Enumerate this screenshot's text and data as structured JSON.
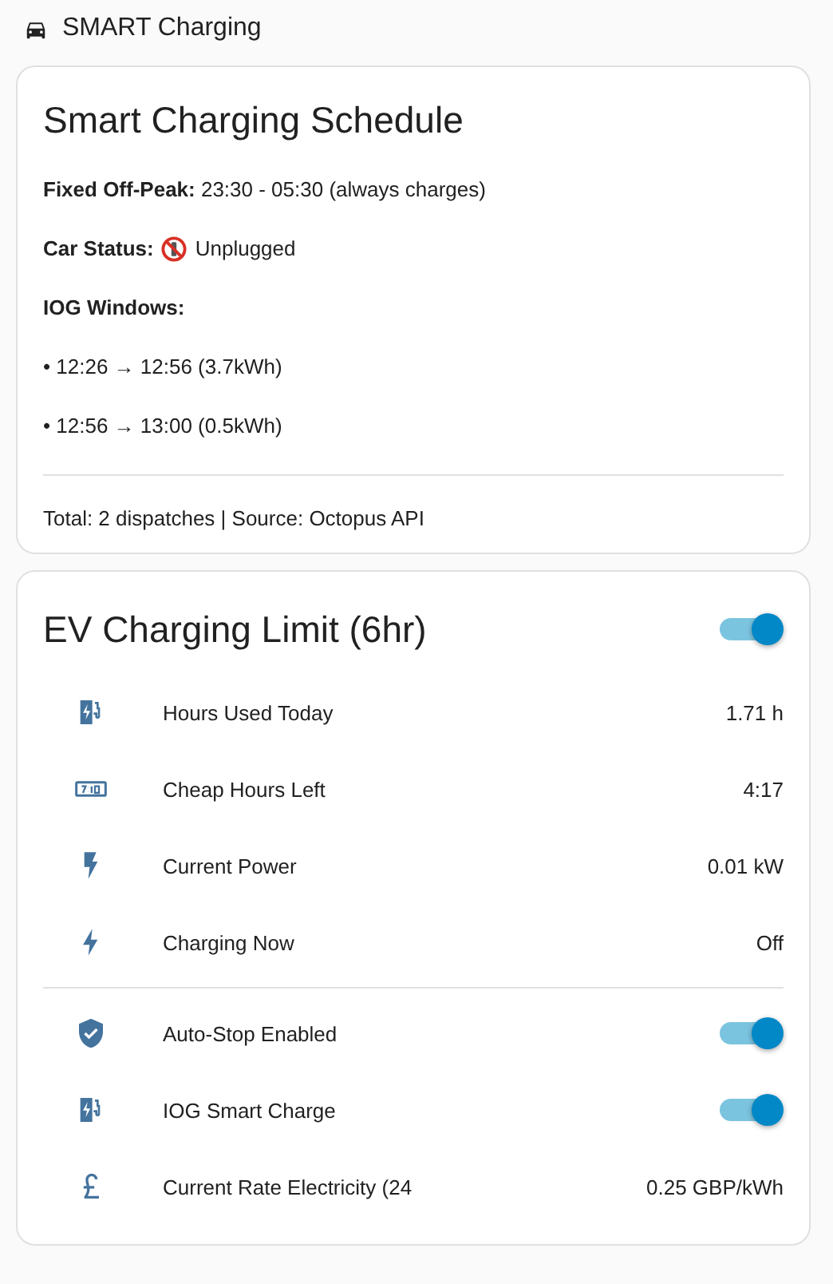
{
  "header": {
    "title": "SMART Charging"
  },
  "schedule": {
    "title": "Smart Charging Schedule",
    "lines": [
      {
        "kind": "text",
        "text": "**Fixed Off-Peak:** 23:30 - 05:30 (always charges)"
      },
      {
        "kind": "status",
        "label": "Car Status:",
        "value": "Unplugged"
      },
      {
        "kind": "heading",
        "text": "IOG Windows:"
      },
      {
        "kind": "text",
        "text": "• 12:26 → 12:56 (3.7kWh)"
      },
      {
        "kind": "text",
        "text": "• 12:56 → 13:00 (0.5kWh)"
      }
    ],
    "footer": "Total: 2 dispatches | Source: Octopus API"
  },
  "limit": {
    "title": "EV Charging Limit (6hr)",
    "on": true,
    "rows": [
      {
        "kind": "value",
        "label": "Hours Used Today",
        "value": "1.71 h"
      },
      {
        "kind": "value",
        "label": "Cheap Hours Left",
        "value": "4:17"
      },
      {
        "kind": "value",
        "label": "Current Power",
        "value": "0.01 kW"
      },
      {
        "kind": "value",
        "label": "Charging Now",
        "value": "Off"
      },
      {
        "kind": "divider"
      },
      {
        "kind": "toggle",
        "label": "Auto-Stop Enabled",
        "on": true
      },
      {
        "kind": "toggle",
        "label": "IOG Smart Charge",
        "on": true
      },
      {
        "kind": "value",
        "label": "Current Rate Electricity (24",
        "value": "0.25 GBP/kWh"
      }
    ]
  }
}
